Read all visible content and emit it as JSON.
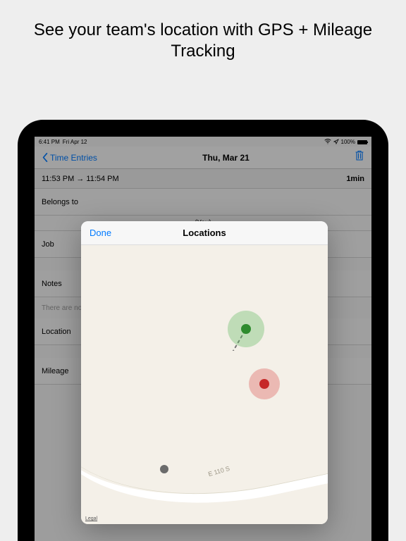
{
  "promo": {
    "title": "See your team's location with GPS + Mileage Tracking"
  },
  "statusbar": {
    "time": "6:41 PM",
    "date": "Fri Apr 12",
    "battery": "100%"
  },
  "nav": {
    "back": "Time Entries",
    "title": "Thu, Mar 21"
  },
  "entry": {
    "start": "11:53 PM",
    "arrow": "→",
    "end": "11:54 PM",
    "duration": "1min"
  },
  "fields": {
    "belongs_to": "Belongs to",
    "you": "(You)",
    "job": "Job",
    "notes": "Notes",
    "notes_placeholder": "There are no",
    "location": "Location",
    "mileage": "Mileage"
  },
  "modal": {
    "done": "Done",
    "title": "Locations",
    "road": "E 110 S",
    "legal": "Legal"
  }
}
